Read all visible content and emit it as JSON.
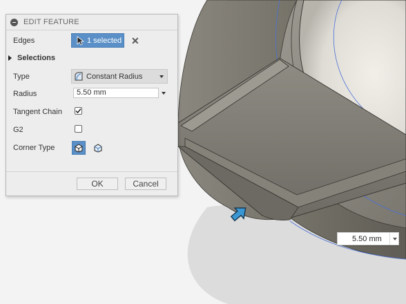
{
  "panel": {
    "title": "EDIT FEATURE",
    "edges_label": "Edges",
    "edges_value": "1 selected",
    "selections_label": "Selections",
    "type_label": "Type",
    "type_value": "Constant Radius",
    "radius_label": "Radius",
    "radius_value": "5.50 mm",
    "tangent_chain_label": "Tangent Chain",
    "tangent_chain_checked": true,
    "g2_label": "G2",
    "g2_checked": false,
    "corner_type_label": "Corner Type",
    "ok_label": "OK",
    "cancel_label": "Cancel"
  },
  "canvas": {
    "dimension_value": "5.50 mm"
  },
  "colors": {
    "accent": "#5a90c7",
    "model": "#7d7a72",
    "handle": "#3b97d3"
  }
}
